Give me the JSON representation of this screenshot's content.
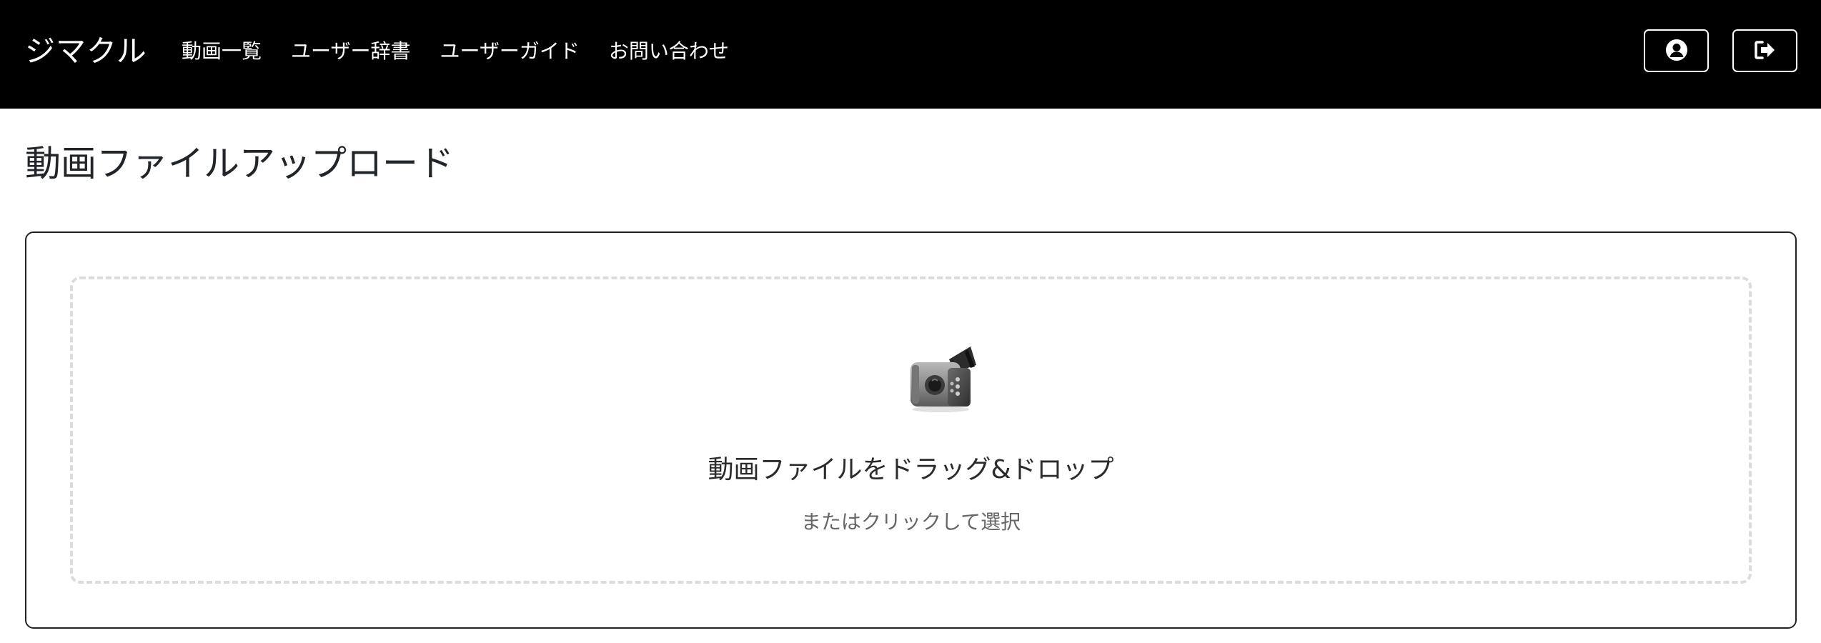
{
  "header": {
    "brand": "ジマクル",
    "nav": [
      {
        "label": "動画一覧"
      },
      {
        "label": "ユーザー辞書"
      },
      {
        "label": "ユーザーガイド"
      },
      {
        "label": "お問い合わせ"
      }
    ],
    "user_icon": "user-circle-icon",
    "logout_icon": "sign-out-icon"
  },
  "main": {
    "title": "動画ファイルアップロード",
    "dropzone": {
      "icon": "video-camera-icon",
      "title": "動画ファイルをドラッグ&ドロップ",
      "subtitle": "またはクリックして選択"
    }
  }
}
